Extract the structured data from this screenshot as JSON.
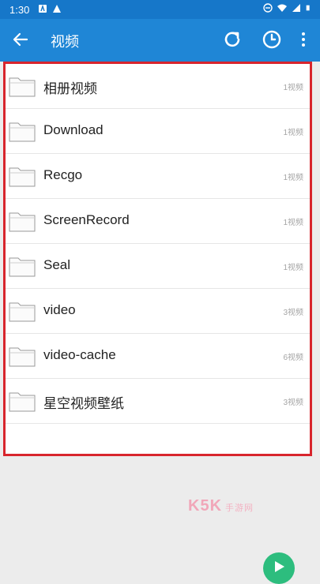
{
  "status_bar": {
    "time": "1:30"
  },
  "app_bar": {
    "title": "视频"
  },
  "folders": [
    {
      "name": "相册视频",
      "count": "1视频"
    },
    {
      "name": "Download",
      "count": "1视频"
    },
    {
      "name": "Recgo",
      "count": "1视频"
    },
    {
      "name": "ScreenRecord",
      "count": "1视频"
    },
    {
      "name": "Seal",
      "count": "1视频"
    },
    {
      "name": "video",
      "count": "3视频"
    },
    {
      "name": "video-cache",
      "count": "6视频"
    },
    {
      "name": "星空视频壁纸",
      "count": "3视频"
    }
  ],
  "watermark": {
    "logo": "K5K",
    "text": "手游网"
  },
  "colors": {
    "app_bar": "#1f86d6",
    "status_bar": "#1677c9",
    "highlight": "#d8252d",
    "fab": "#2dbd7e"
  },
  "icons": {
    "back": "arrow-left-icon",
    "refresh": "refresh-icon",
    "history": "clock-icon",
    "more": "more-vert-icon",
    "folder": "folder-icon"
  }
}
